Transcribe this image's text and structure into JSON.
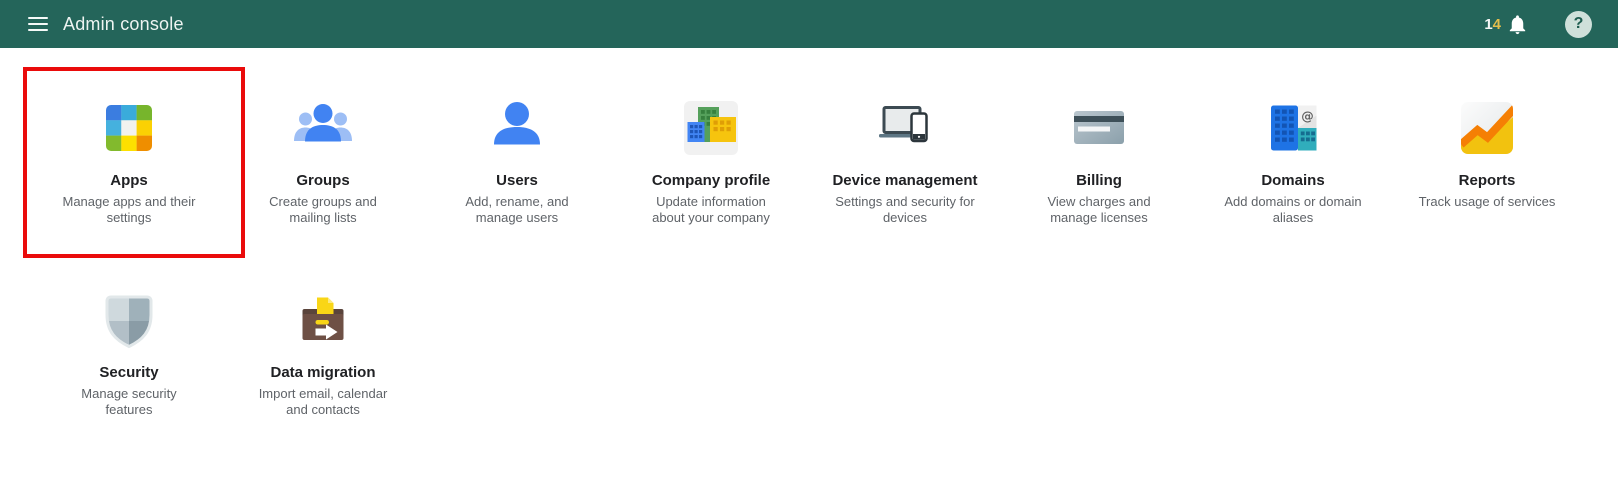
{
  "header": {
    "title": "Admin console",
    "notification_count": "14",
    "notification_digits": [
      "1",
      "4"
    ],
    "help_glyph": "?",
    "icons": [
      "menu-icon",
      "bell-icon",
      "help-icon"
    ]
  },
  "colors": {
    "header_bg": "#24655a",
    "header_text": "#edf4f1",
    "notification_digit_yellow": "#e2bd4c",
    "highlight_border": "#ea0b0b",
    "tile_title": "#202124",
    "tile_description": "#5f6368",
    "accent_blue": "#4183f2",
    "page_bg": "#ffffff"
  },
  "tiles": [
    {
      "id": "apps",
      "title": "Apps",
      "description_lines": [
        "Manage apps and their",
        "settings"
      ],
      "icon": "apps-grid-icon",
      "row": 1,
      "highlighted": true
    },
    {
      "id": "groups",
      "title": "Groups",
      "description_lines": [
        "Create groups and",
        "mailing lists"
      ],
      "icon": "groups-people-icon",
      "row": 1,
      "highlighted": false
    },
    {
      "id": "users",
      "title": "Users",
      "description_lines": [
        "Add, rename, and",
        "manage users"
      ],
      "icon": "user-person-icon",
      "row": 1,
      "highlighted": false
    },
    {
      "id": "company-profile",
      "title": "Company profile",
      "description_lines": [
        "Update information",
        "about your company"
      ],
      "icon": "company-buildings-icon",
      "row": 1,
      "highlighted": false
    },
    {
      "id": "device-management",
      "title": "Device management",
      "description_lines": [
        "Settings and security for",
        "devices"
      ],
      "icon": "laptop-phone-icon",
      "row": 1,
      "highlighted": false
    },
    {
      "id": "billing",
      "title": "Billing",
      "description_lines": [
        "View charges and",
        "manage licenses"
      ],
      "icon": "credit-card-icon",
      "row": 1,
      "highlighted": false
    },
    {
      "id": "domains",
      "title": "Domains",
      "description_lines": [
        "Add domains or domain",
        "aliases"
      ],
      "icon": "domain-building-icon",
      "row": 1,
      "highlighted": false
    },
    {
      "id": "reports",
      "title": "Reports",
      "description_lines": [
        "Track usage of services"
      ],
      "icon": "area-chart-icon",
      "row": 1,
      "highlighted": false
    },
    {
      "id": "security",
      "title": "Security",
      "description_lines": [
        "Manage security",
        "features"
      ],
      "icon": "shield-icon",
      "row": 2,
      "highlighted": false
    },
    {
      "id": "data-migration",
      "title": "Data migration",
      "description_lines": [
        "Import email, calendar",
        "and contacts"
      ],
      "icon": "migration-box-icon",
      "row": 2,
      "highlighted": false
    }
  ]
}
